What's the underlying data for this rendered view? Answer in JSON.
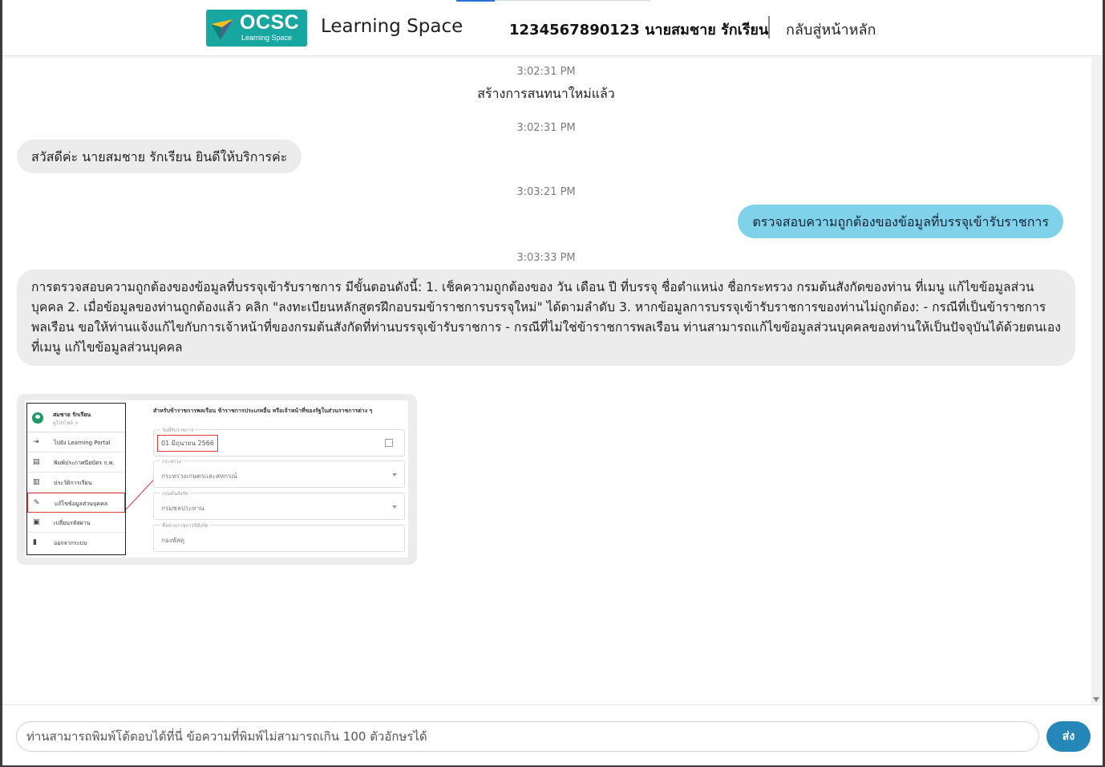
{
  "header": {
    "logo_text": "OCSC",
    "logo_subtext": "Learning Space",
    "app_title": "Learning Space",
    "user_info": "1234567890123 นายสมชาย รักเรียน",
    "home_link": "กลับสู่หน้าหลัก"
  },
  "messages": [
    {
      "time": "3:02:31 PM",
      "text": "สร้างการสนทนาใหม่แล้ว",
      "kind": "system"
    },
    {
      "time": "3:02:31 PM",
      "text": "สวัสดีค่ะ นายสมชาย รักเรียน ยินดีให้บริการค่ะ",
      "kind": "bot"
    },
    {
      "time": "3:03:21 PM",
      "text": "ตรวจสอบความถูกต้องของข้อมูลที่บรรจุเข้ารับราชการ",
      "kind": "user"
    },
    {
      "time": "3:03:33 PM",
      "text": "การตรวจสอบความถูกต้องของข้อมูลที่บรรจุเข้ารับราชการ มีขั้นตอนดังนี้: 1. เช็คความถูกต้องของ วัน เดือน ปี ที่บรรจุ ชื่อตำแหน่ง ชื่อกระทรวง กรมต้นสังกัดของท่าน ที่เมนู แก้ไขข้อมูลส่วนบุคคล 2. เมื่อข้อมูลของท่านถูกต้องแล้ว คลิก \"ลงทะเบียนหลักสูตรฝึกอบรมข้าราชการบรรจุใหม่\" ได้ตามลำดับ 3. หากข้อมูลการบรรจุเข้ารับราชการของท่านไม่ถูกต้อง: - กรณีที่เป็นข้าราชการพลเรือน ขอให้ท่านแจ้งแก้ไขกับการเจ้าหน้าที่ของกรมต้นสังกัดที่ท่านบรรจุเข้ารับราชการ - กรณีที่ไม่ใช่ข้าราชการพลเรือน ท่านสามารถแก้ไขข้อมูลส่วนบุคคลของท่านให้เป็นปัจจุบันได้ด้วยตนเองที่เมนู แก้ไขข้อมูลส่วนบุคคล",
      "kind": "bot"
    }
  ],
  "screenshot": {
    "user_name": "สมชาย รักเรียน",
    "profile_link": "ดูโปรไฟล์ >",
    "menu": [
      {
        "icon": "login-icon",
        "glyph": "⇥",
        "label": "ไปยัง Learning Portal"
      },
      {
        "icon": "printer-icon",
        "glyph": "▤",
        "label": "พิมพ์ประกาศนียบัตร ก.พ."
      },
      {
        "icon": "book-icon",
        "glyph": "▥",
        "label": "ประวัติการเรียน"
      },
      {
        "icon": "pencil-icon",
        "glyph": "✎",
        "label": "แก้ไขข้อมูลส่วนบุคคล"
      },
      {
        "icon": "lock-icon",
        "glyph": "▣",
        "label": "เปลี่ยนรหัสผ่าน"
      },
      {
        "icon": "logout-icon",
        "glyph": "▮",
        "label": "ออกจากระบบ"
      }
    ],
    "form_title": "สำหรับข้าราชการพลเรือน ข้าราชการประเภทอื่น หรือเจ้าหน้าที่ของรัฐในส่วนราชการต่าง ๆ",
    "fields": [
      {
        "label": "วันที่รับราชการ",
        "value": "01 มิถุนายน 2566"
      },
      {
        "label": "กระทรวง",
        "value": "กระทรวงเกษตรและสหกรณ์"
      },
      {
        "label": "กรมต้นสังกัด",
        "value": "กรมชลประทาน"
      },
      {
        "label": "ชื่อส่วนราชการที่สังกัด",
        "value": "กองพัสดุ"
      }
    ],
    "highlight_color": "#e0393b"
  },
  "composer": {
    "placeholder": "ท่านสามารถพิมพ์โต้ตอบได้ที่นี่ ข้อความที่พิมพ์ไม่สามารถเกิน 100 ตัวอักษรได้",
    "send_label": "ส่ง"
  },
  "colors": {
    "user_bubble": "#7fd2ea",
    "bot_bubble": "#ececec",
    "send_button": "#2487b7",
    "logo_bg": "#18a6a0"
  }
}
